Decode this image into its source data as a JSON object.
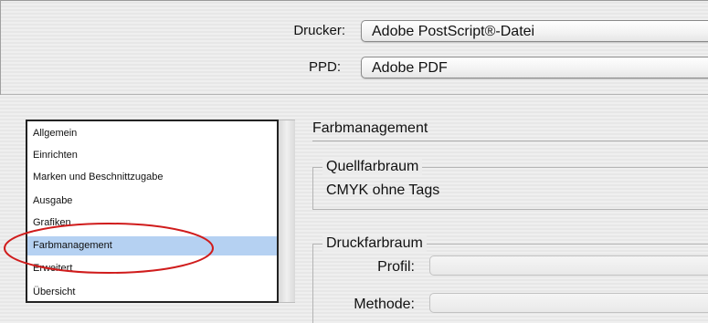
{
  "printer": {
    "label": "Drucker:",
    "value": "Adobe PostScript®-Datei"
  },
  "ppd": {
    "label": "PPD:",
    "value": "Adobe PDF"
  },
  "categories": {
    "items": [
      "Allgemein",
      "Einrichten",
      "Marken und Beschnittzugabe",
      "Ausgabe",
      "Grafiken",
      "Farbmanagement",
      "Erweitert",
      "Übersicht"
    ],
    "selected": "Farbmanagement"
  },
  "panel": {
    "title": "Farbmanagement",
    "source_space": {
      "title": "Quellfarbraum",
      "value": "CMYK ohne Tags"
    },
    "print_space": {
      "title": "Druckfarbraum",
      "profile_label": "Profil:",
      "profile_value": "",
      "method_label": "Methode:",
      "method_value": ""
    }
  },
  "annotation": {
    "color": "#d01c1c",
    "shape": "ellipse",
    "target": "Farbmanagement"
  },
  "colors": {
    "selection": "#b5d1f2",
    "annotation": "#d01c1c"
  }
}
